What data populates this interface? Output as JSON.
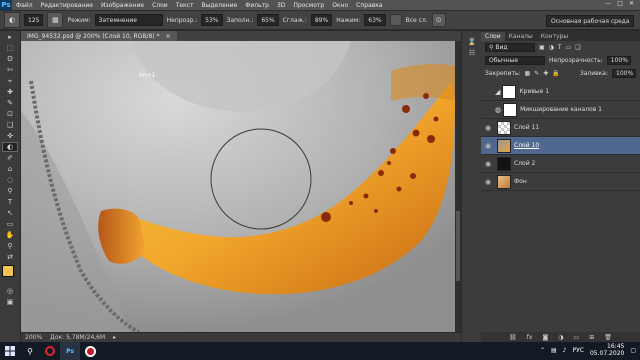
{
  "app": {
    "logo": "Ps"
  },
  "menu": [
    "Файл",
    "Редактирование",
    "Изображение",
    "Слои",
    "Текст",
    "Выделение",
    "Фильтр",
    "3D",
    "Просмотр",
    "Окно",
    "Справка"
  ],
  "window_controls": [
    "—",
    "□",
    "✕"
  ],
  "options": {
    "brush_size": "125",
    "mode_label": "Режим:",
    "mode_value": "Затемнение",
    "opacity_label": "Непрозр.:",
    "opacity_value": "53%",
    "flow_label": "Заполн.:",
    "flow_value": "65%",
    "smoothing_label": "Сглаж.:",
    "smoothing_value": "89%",
    "pressure_label": "Нажим:",
    "pressure_value": "63%",
    "all_layers_label": "Все сл.",
    "workspace": "Основная рабочая среда"
  },
  "tools": [
    "▸",
    "⬚",
    "ʘ",
    "✄",
    "⌖",
    "✚",
    "✎",
    "⊡",
    "❑",
    "✜",
    "◐",
    "✐",
    "⌂",
    "◌",
    "⚲",
    "T",
    "↖",
    "▭",
    "✋",
    "⚲",
    "⇄"
  ],
  "document": {
    "tab": "IMG_94532.psd @ 200% (Слой 10, RGB/8) *",
    "tab_close": "×",
    "zoom": "200%",
    "doc_size": "Док: 5,78M/24,6M"
  },
  "canvas_marks": {
    "label": "Im+1"
  },
  "layers_panel": {
    "tabs": [
      "Слои",
      "Каналы",
      "Контуры"
    ],
    "filter_label": "Вид",
    "blend_mode": "Обычные",
    "opacity_label": "Непрозрачность:",
    "opacity_value": "100%",
    "lock_label": "Закрепить:",
    "fill_label": "Заливка:",
    "fill_value": "100%",
    "layers": [
      {
        "name": "Кривые 1",
        "visible": false,
        "thumb": "adjust"
      },
      {
        "name": "Микширование каналов 1",
        "visible": false,
        "thumb": "adjust"
      },
      {
        "name": "Слой 11",
        "visible": true,
        "thumb": "transparent"
      },
      {
        "name": "Слой 10",
        "visible": true,
        "thumb": "photo"
      },
      {
        "name": "Слой 2",
        "visible": true,
        "thumb": "dark"
      },
      {
        "name": "Фон",
        "visible": true,
        "thumb": "photo"
      }
    ],
    "footer_icons": [
      "⛓",
      "fx",
      "◙",
      "◑",
      "▭",
      "⊞",
      "🗑"
    ]
  },
  "taskbar": {
    "lang": "РУС",
    "time": "16:45",
    "date": "05.07.2020",
    "apps": [
      {
        "name": "windows",
        "color": "#dfe8ff"
      },
      {
        "name": "opera",
        "color": "#e0232e"
      },
      {
        "name": "photoshop",
        "color": "#0f3b63"
      },
      {
        "name": "recorder",
        "color": "#c8152b"
      }
    ]
  },
  "colors": {
    "accent_selected_layer": "#506890",
    "foreground_swatch": "#f0c250",
    "background_swatch": "#ffffff"
  }
}
